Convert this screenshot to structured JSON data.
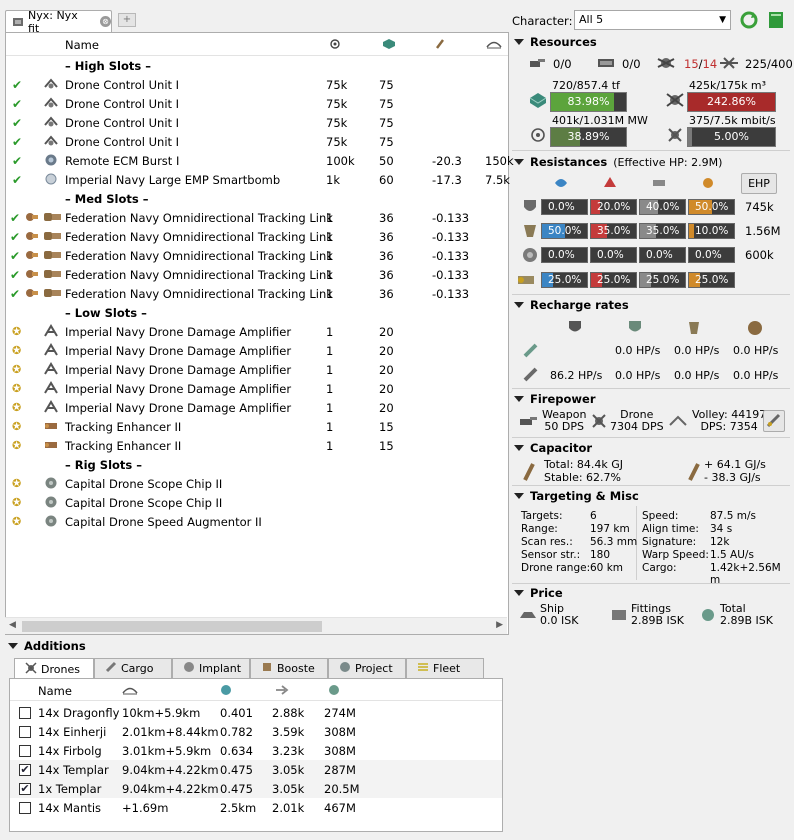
{
  "tab": {
    "title": "Nyx: Nyx fit",
    "close": "⊗",
    "add": "+"
  },
  "fit": {
    "headers": {
      "name": "Name"
    },
    "rows": [
      {
        "type": "header",
        "label": "– High Slots –"
      },
      {
        "state": "check",
        "icon": "drone-control-icon",
        "name": "Drone Control Unit I",
        "c1": "75k",
        "c2": "75",
        "c3": "",
        "c4": ""
      },
      {
        "state": "check",
        "icon": "drone-control-icon",
        "name": "Drone Control Unit I",
        "c1": "75k",
        "c2": "75",
        "c3": "",
        "c4": ""
      },
      {
        "state": "check",
        "icon": "drone-control-icon",
        "name": "Drone Control Unit I",
        "c1": "75k",
        "c2": "75",
        "c3": "",
        "c4": ""
      },
      {
        "state": "check",
        "icon": "drone-control-icon",
        "name": "Drone Control Unit I",
        "c1": "75k",
        "c2": "75",
        "c3": "",
        "c4": ""
      },
      {
        "state": "check",
        "icon": "ecm-burst-icon",
        "name": "Remote ECM Burst I",
        "c1": "100k",
        "c2": "50",
        "c3": "-20.3",
        "c4": "150k"
      },
      {
        "state": "check",
        "icon": "smartbomb-icon",
        "name": "Imperial Navy Large EMP Smartbomb",
        "c1": "1k",
        "c2": "60",
        "c3": "-17.3",
        "c4": "7.5k"
      },
      {
        "type": "header",
        "label": "– Med Slots –"
      },
      {
        "state": "charged",
        "icon": "tracking-link-icon",
        "name": "Federation Navy Omnidirectional Tracking Link",
        "c1": "1",
        "c2": "36",
        "c3": "-0.133",
        "c4": ""
      },
      {
        "state": "charged",
        "icon": "tracking-link-icon",
        "name": "Federation Navy Omnidirectional Tracking Link",
        "c1": "1",
        "c2": "36",
        "c3": "-0.133",
        "c4": ""
      },
      {
        "state": "charged",
        "icon": "tracking-link-icon",
        "name": "Federation Navy Omnidirectional Tracking Link",
        "c1": "1",
        "c2": "36",
        "c3": "-0.133",
        "c4": ""
      },
      {
        "state": "charged",
        "icon": "tracking-link-icon",
        "name": "Federation Navy Omnidirectional Tracking Link",
        "c1": "1",
        "c2": "36",
        "c3": "-0.133",
        "c4": ""
      },
      {
        "state": "charged",
        "icon": "tracking-link-icon",
        "name": "Federation Navy Omnidirectional Tracking Link",
        "c1": "1",
        "c2": "36",
        "c3": "-0.133",
        "c4": ""
      },
      {
        "type": "header",
        "label": "– Low Slots –"
      },
      {
        "state": "passive",
        "icon": "damage-amplifier-icon",
        "name": "Imperial Navy Drone Damage Amplifier",
        "c1": "1",
        "c2": "20",
        "c3": "",
        "c4": ""
      },
      {
        "state": "passive",
        "icon": "damage-amplifier-icon",
        "name": "Imperial Navy Drone Damage Amplifier",
        "c1": "1",
        "c2": "20",
        "c3": "",
        "c4": ""
      },
      {
        "state": "passive",
        "icon": "damage-amplifier-icon",
        "name": "Imperial Navy Drone Damage Amplifier",
        "c1": "1",
        "c2": "20",
        "c3": "",
        "c4": ""
      },
      {
        "state": "passive",
        "icon": "damage-amplifier-icon",
        "name": "Imperial Navy Drone Damage Amplifier",
        "c1": "1",
        "c2": "20",
        "c3": "",
        "c4": ""
      },
      {
        "state": "passive",
        "icon": "damage-amplifier-icon",
        "name": "Imperial Navy Drone Damage Amplifier",
        "c1": "1",
        "c2": "20",
        "c3": "",
        "c4": ""
      },
      {
        "state": "passive",
        "icon": "tracking-enhancer-icon",
        "name": "Tracking Enhancer II",
        "c1": "1",
        "c2": "15",
        "c3": "",
        "c4": ""
      },
      {
        "state": "passive",
        "icon": "tracking-enhancer-icon",
        "name": "Tracking Enhancer II",
        "c1": "1",
        "c2": "15",
        "c3": "",
        "c4": ""
      },
      {
        "type": "header",
        "label": "– Rig Slots –"
      },
      {
        "state": "passive",
        "icon": "rig-icon",
        "name": "Capital Drone Scope Chip II",
        "c1": "",
        "c2": "",
        "c3": "",
        "c4": ""
      },
      {
        "state": "passive",
        "icon": "rig-icon",
        "name": "Capital Drone Scope Chip II",
        "c1": "",
        "c2": "",
        "c3": "",
        "c4": ""
      },
      {
        "state": "passive",
        "icon": "rig-icon",
        "name": "Capital Drone Speed Augmentor II",
        "c1": "",
        "c2": "",
        "c3": "",
        "c4": ""
      }
    ]
  },
  "character": {
    "label": "Character:",
    "value": "All 5"
  },
  "resources": {
    "title": "Resources",
    "turret": "0/0",
    "launcher": "0/0",
    "drones_used": "15",
    "drones_sep": "/",
    "drones_total": "14",
    "bandwidth_count": "225/400",
    "cpu_label": "720/857.4 tf",
    "cpu_pct": "83.98%",
    "cpu_frac": 0.8398,
    "bay_label": "425k/175k m³",
    "bay_pct": "242.86%",
    "bay_frac": 1.0,
    "pg_label": "401k/1.031M MW",
    "pg_pct": "38.89%",
    "pg_frac": 0.3889,
    "bw_label": "375/7.5k mbit/s",
    "bw_pct": "5.00%",
    "bw_frac": 0.05
  },
  "resistances": {
    "title": "Resistances",
    "ehp": "(Effective HP: 2.9M)",
    "ehp_button": "EHP",
    "rows": [
      {
        "layer": "shield",
        "cells": [
          "0.0%",
          "20.0%",
          "40.0%",
          "50.0%"
        ],
        "fracs": [
          0.0,
          0.2,
          0.4,
          0.5
        ],
        "hp": "745k"
      },
      {
        "layer": "armor",
        "cells": [
          "50.0%",
          "35.0%",
          "35.0%",
          "10.0%"
        ],
        "fracs": [
          0.5,
          0.35,
          0.35,
          0.1
        ],
        "hp": "1.56M"
      },
      {
        "layer": "hull",
        "cells": [
          "0.0%",
          "0.0%",
          "0.0%",
          "0.0%"
        ],
        "fracs": [
          0,
          0,
          0,
          0
        ],
        "hp": "600k"
      },
      {
        "layer": "damage-profile",
        "cells": [
          "25.0%",
          "25.0%",
          "25.0%",
          "25.0%"
        ],
        "fracs": [
          0.25,
          0.25,
          0.25,
          0.25
        ],
        "hp": ""
      }
    ]
  },
  "recharge": {
    "title": "Recharge rates",
    "r1": [
      "",
      "0.0 HP/s",
      "0.0 HP/s",
      "0.0 HP/s"
    ],
    "r2": [
      "86.2 HP/s",
      "0.0 HP/s",
      "0.0 HP/s",
      "0.0 HP/s"
    ]
  },
  "firepower": {
    "title": "Firepower",
    "weapon_label": "Weapon",
    "weapon_dps": "50 DPS",
    "drone_label": "Drone",
    "drone_dps": "7304 DPS",
    "volley": "Volley: 44197",
    "dps": "DPS: 7354"
  },
  "capacitor": {
    "title": "Capacitor",
    "total": "Total: 84.4k GJ",
    "stable": "Stable: 62.7%",
    "plus": "+ 64.1 GJ/s",
    "minus": "- 38.3 GJ/s"
  },
  "targeting": {
    "title": "Targeting & Misc",
    "left": [
      [
        "Targets:",
        "6"
      ],
      [
        "Range:",
        "197 km"
      ],
      [
        "Scan res.:",
        "56.3 mm"
      ],
      [
        "Sensor str.:",
        "180"
      ],
      [
        "Drone range:",
        "60 km"
      ]
    ],
    "right": [
      [
        "Speed:",
        "87.5 m/s"
      ],
      [
        "Align time:",
        "34 s"
      ],
      [
        "Signature:",
        "12k"
      ],
      [
        "Warp Speed:",
        "1.5 AU/s"
      ],
      [
        "Cargo:",
        "1.42k+2.56M m"
      ]
    ]
  },
  "price": {
    "title": "Price",
    "ship_label": "Ship",
    "ship": "0.0 ISK",
    "fittings_label": "Fittings",
    "fittings": "2.89B ISK",
    "total_label": "Total",
    "total": "2.89B ISK"
  },
  "additions": {
    "title": "Additions",
    "tabs": [
      "Drones",
      "Cargo",
      "Implant",
      "Booste",
      "Project",
      "Fleet"
    ],
    "header": {
      "name": "Name"
    },
    "rows": [
      {
        "checked": false,
        "name": "14x Dragonfly",
        "range": "10km+5.9km",
        "speed": "0.401",
        "dps": "2.88k",
        "price": "274M"
      },
      {
        "checked": false,
        "name": "14x Einherji",
        "range": "2.01km+8.44km",
        "speed": "0.782",
        "dps": "3.59k",
        "price": "308M"
      },
      {
        "checked": false,
        "name": "14x Firbolg",
        "range": "3.01km+5.9km",
        "speed": "0.634",
        "dps": "3.23k",
        "price": "308M"
      },
      {
        "checked": true,
        "name": "14x Templar",
        "range": "9.04km+4.22km",
        "speed": "0.475",
        "dps": "3.05k",
        "price": "287M"
      },
      {
        "checked": true,
        "name": "1x Templar",
        "range": "9.04km+4.22km",
        "speed": "0.475",
        "dps": "3.05k",
        "price": "20.5M"
      },
      {
        "checked": false,
        "name": "14x Mantis",
        "range": "+1.69m",
        "speed": "2.5km",
        "dps": "2.01k",
        "price": "467M"
      }
    ]
  }
}
